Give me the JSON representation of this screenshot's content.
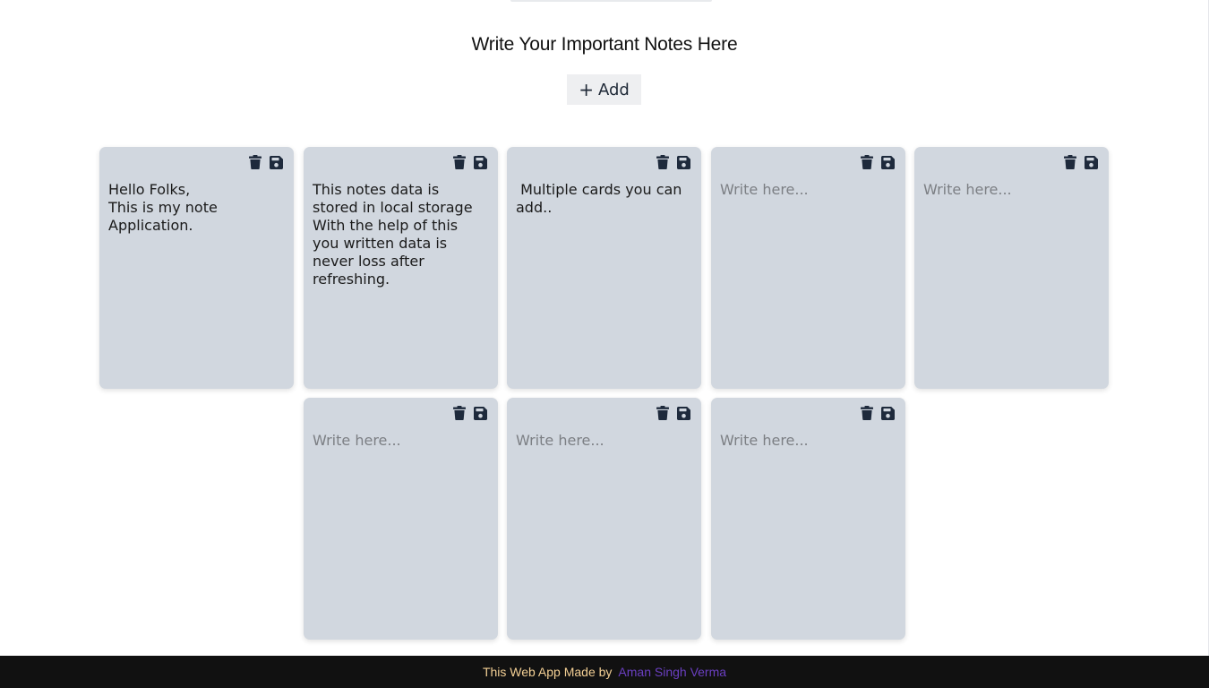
{
  "header": {
    "title": "Write Your Important Notes Here"
  },
  "toolbar": {
    "add_label": "Add",
    "add_icon": "plus-icon"
  },
  "notes": [
    {
      "text": "Hello Folks,\nThis is my note Application.",
      "placeholder": "Write here..."
    },
    {
      "text": "This notes data is stored in local storage With the help of this you written data is never loss after refreshing.",
      "placeholder": "Write here..."
    },
    {
      "text": " Multiple cards you can add..",
      "placeholder": "Write here..."
    },
    {
      "text": "",
      "placeholder": "Write here..."
    },
    {
      "text": "",
      "placeholder": "Write here..."
    },
    {
      "text": "",
      "placeholder": "Write here..."
    },
    {
      "text": "",
      "placeholder": "Write here..."
    },
    {
      "text": "",
      "placeholder": "Write here..."
    }
  ],
  "card_icons": {
    "delete": "trash-icon",
    "save": "floppy-disk-icon"
  },
  "footer": {
    "text": "This Web App Made by",
    "author": "Aman Singh Verma"
  },
  "colors": {
    "card_background": "#d1d7df",
    "icon_color": "#1e2a3c",
    "footer_background": "#111111",
    "footer_text": "#f3cf94",
    "author_link": "#6a3fc0"
  }
}
